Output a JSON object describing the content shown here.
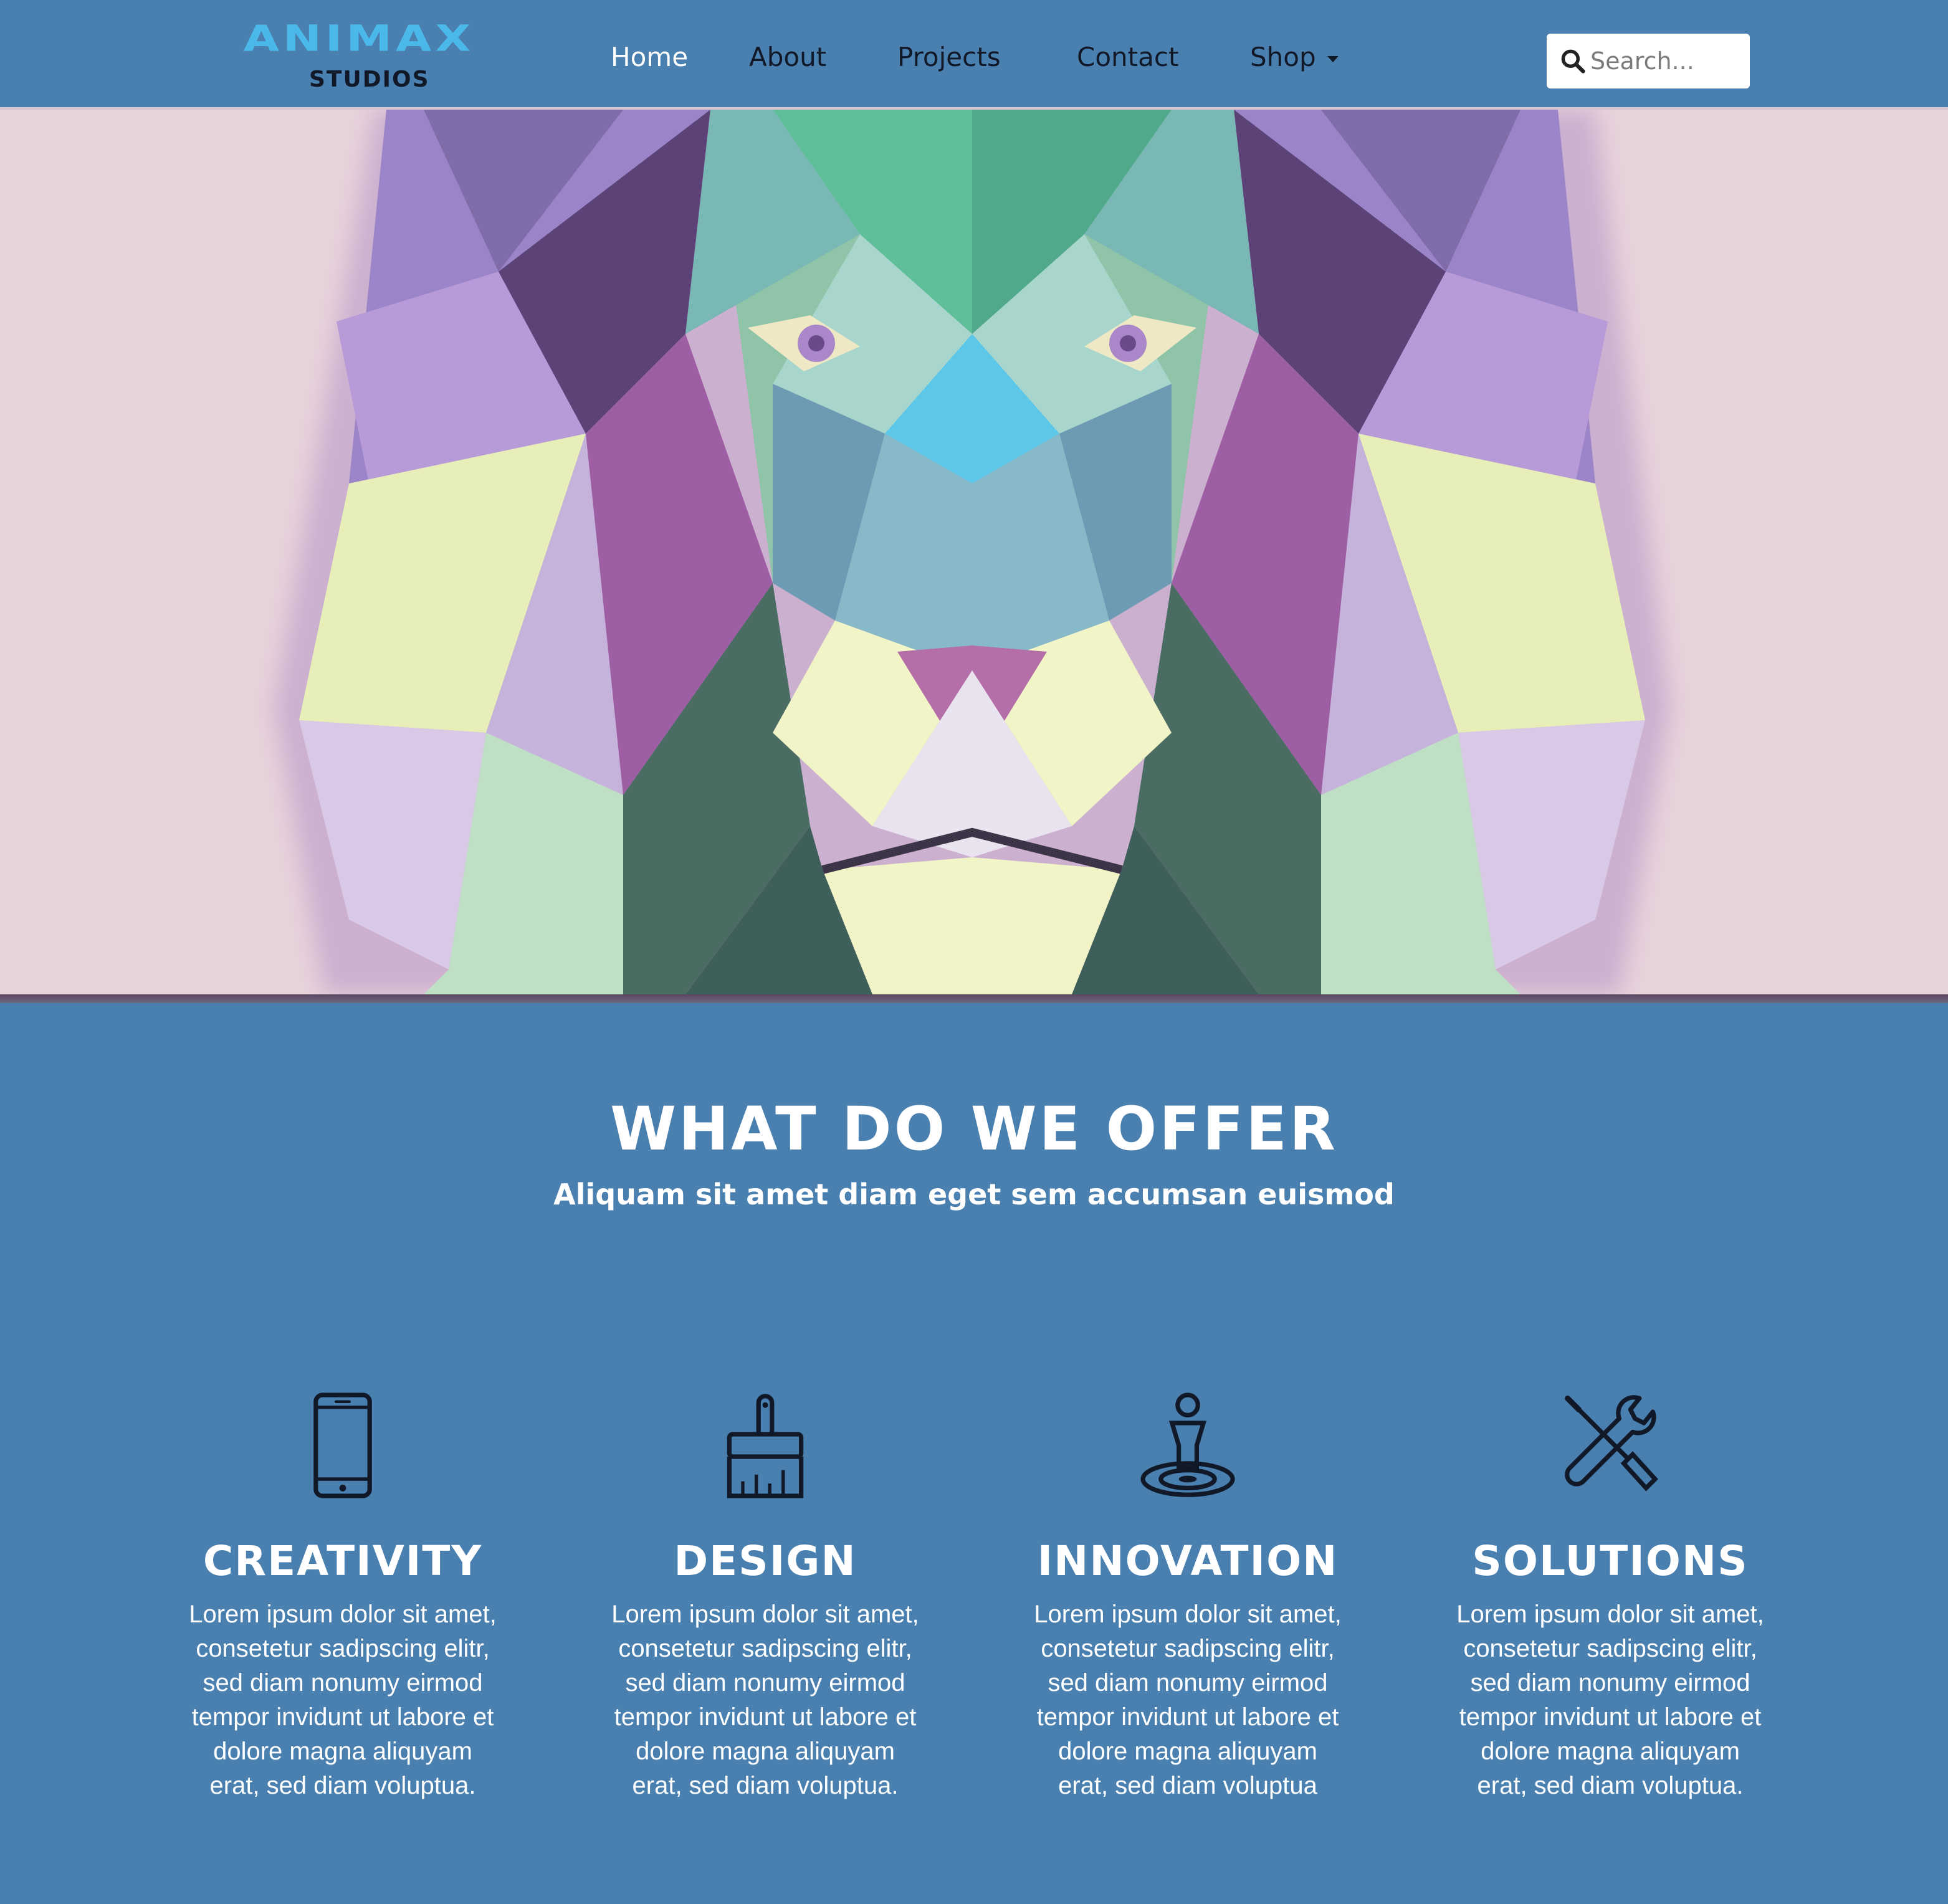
{
  "brand": {
    "name": "ANIMAX",
    "sub": "STUDIOS",
    "logo_color": "#4bb8ea"
  },
  "nav": {
    "items": [
      {
        "label": "Home",
        "active": true
      },
      {
        "label": "About"
      },
      {
        "label": "Projects"
      },
      {
        "label": "Contact"
      },
      {
        "label": "Shop",
        "dropdown": true
      }
    ]
  },
  "search": {
    "placeholder": "Search...",
    "icon": "search-icon"
  },
  "hero": {
    "image": "polygonal lion illustration",
    "background": "#e7d3db"
  },
  "offer": {
    "title": "WHAT DO WE OFFER",
    "subtitle": "Aliquam sit amet diam eget sem accumsan euismod",
    "features": [
      {
        "icon": "smartphone-icon",
        "title": "CREATIVITY",
        "text": "Lorem ipsum dolor sit amet, consetetur sadipscing elitr, sed diam nonumy eirmod tempor invidunt ut labore et dolore magna aliquyam erat, sed diam voluptua."
      },
      {
        "icon": "paintbrush-icon",
        "title": "DESIGN",
        "text": "Lorem ipsum dolor sit amet, consetetur sadipscing elitr, sed diam nonumy eirmod tempor invidunt ut labore et dolore magna aliquyam erat, sed diam voluptua."
      },
      {
        "icon": "person-target-icon",
        "title": "INNOVATION",
        "text": "Lorem ipsum dolor sit amet, consetetur sadipscing elitr, sed diam nonumy eirmod tempor invidunt ut labore et dolore magna aliquyam erat, sed diam voluptua"
      },
      {
        "icon": "tools-icon",
        "title": "SOLUTIONS",
        "text": "Lorem ipsum dolor sit amet, consetetur sadipscing elitr, sed diam nonumy eirmod tempor invidunt ut labore et dolore magna aliquyam erat, sed diam voluptua."
      }
    ]
  },
  "colors": {
    "primary": "#4a80b0",
    "nav_text": "#111827",
    "active_text": "#ffffff"
  }
}
